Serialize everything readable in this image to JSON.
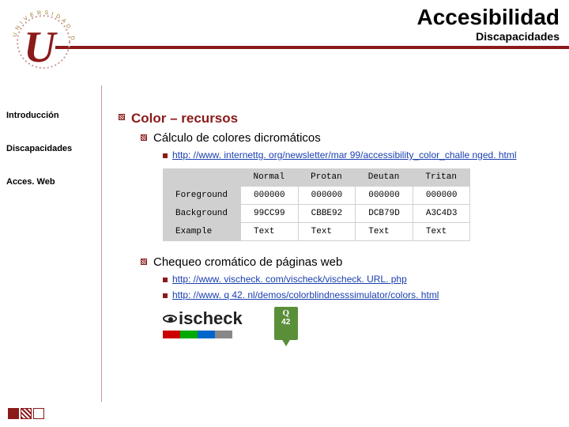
{
  "header": {
    "title": "Accesibilidad",
    "subtitle": "Discapacidades"
  },
  "logo": {
    "letter": "U",
    "ring_text": "UNIVERSIDAD DE SEVILLA"
  },
  "sidebar": {
    "items": [
      {
        "label": "Introducción"
      },
      {
        "label": "Discapacidades"
      },
      {
        "label": "Acces. Web"
      }
    ]
  },
  "content": {
    "section_title": "Color – recursos",
    "item1": {
      "label": "Cálculo de colores dicromáticos",
      "link": "http: //www. internettg. org/newsletter/mar 99/accessibility_color_challe nged. html"
    },
    "table": {
      "cols": [
        "Normal",
        "Protan",
        "Deutan",
        "Tritan"
      ],
      "rows": [
        {
          "hdr": "Foreground",
          "cells": [
            "000000",
            "000000",
            "000000",
            "000000"
          ]
        },
        {
          "hdr": "Background",
          "cells": [
            "99CC99",
            "CBBE92",
            "DCB79D",
            "A3C4D3"
          ]
        },
        {
          "hdr": "Example",
          "cells": [
            "Text",
            "Text",
            "Text",
            "Text"
          ]
        }
      ]
    },
    "item2": {
      "label": "Chequeo cromático de páginas web",
      "links": [
        "http: //www. vischeck. com/vischeck/vischeck. URL. php",
        "http: //www. q 42. nl/demos/colorblindnesssimulator/colors. html"
      ]
    },
    "vischeck_label": "ischeck",
    "q42": {
      "q": "Q",
      "n": "42"
    }
  }
}
